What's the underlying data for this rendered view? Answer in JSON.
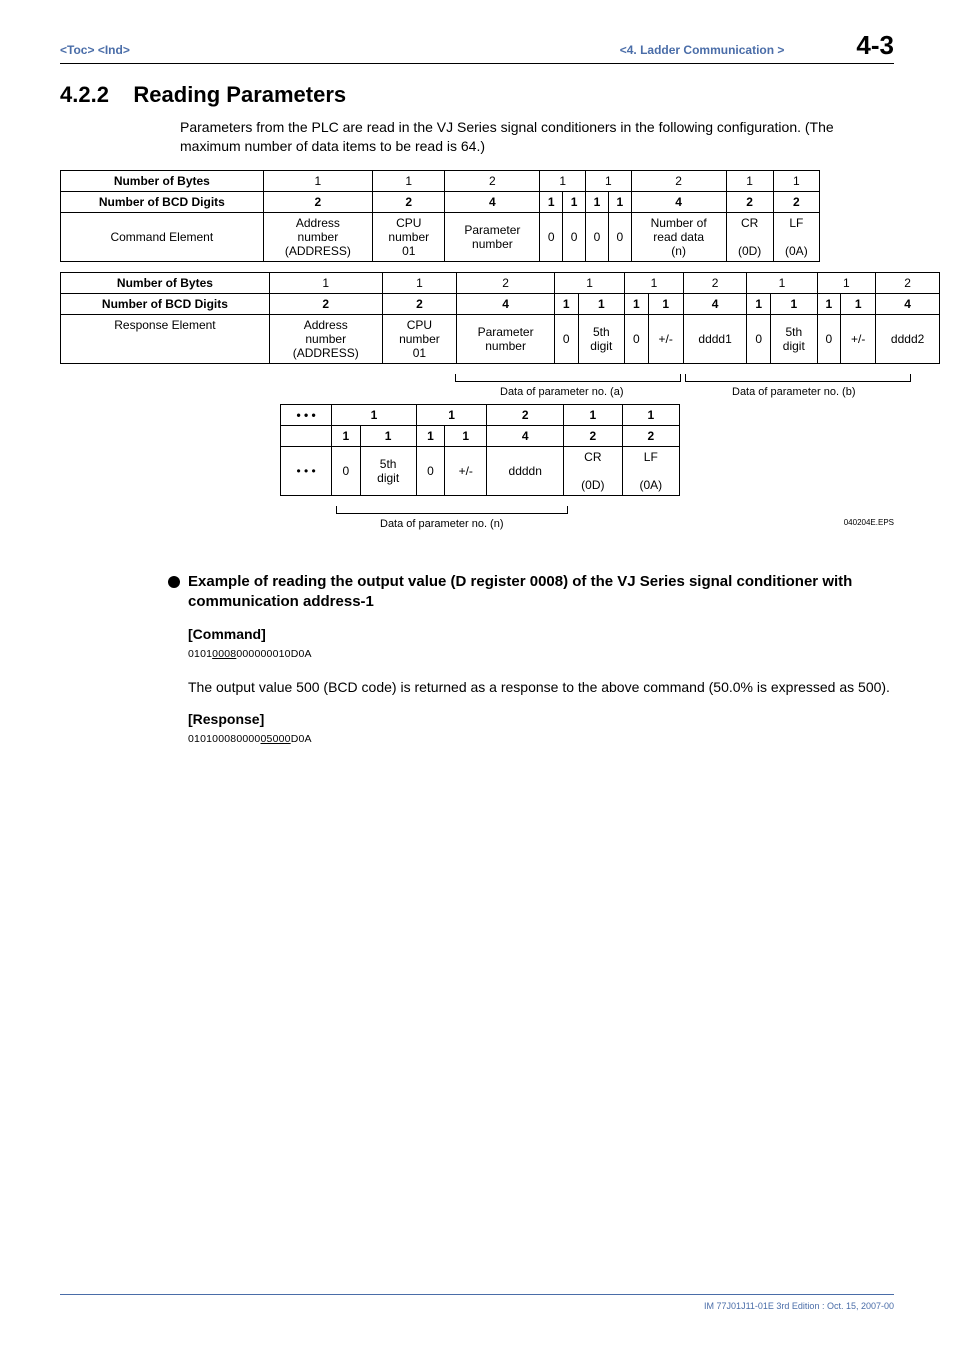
{
  "header": {
    "toc": "<Toc>",
    "ind": "<Ind>",
    "chapter_ref": "<4.  Ladder Communication >",
    "page_num": "4-3"
  },
  "section": {
    "number": "4.2.2",
    "title": "Reading Parameters",
    "intro": "Parameters from the PLC are read in the VJ Series signal conditioners in the following configuration. (The maximum number of data items to be read is 64.)"
  },
  "cmd_table": {
    "rows": {
      "bytes_label": "Number of Bytes",
      "bcd_label": "Number of BCD Digits",
      "elem_label": "Command Element"
    },
    "bytes": [
      "1",
      "1",
      "2",
      "1",
      "1",
      "2",
      "1",
      "1"
    ],
    "bcd": [
      "2",
      "2",
      "4",
      "1",
      "1",
      "1",
      "1",
      "4",
      "2",
      "2"
    ],
    "elem": {
      "c1": "Address\nnumber\n(ADDRESS)",
      "c2": "CPU\nnumber\n01",
      "c3": "Parameter\nnumber",
      "c4": "0",
      "c5": "0",
      "c6": "0",
      "c7": "0",
      "c8": "Number of\nread data\n(n)",
      "c9": "CR\n\n(0D)",
      "c10": "LF\n\n(0A)"
    }
  },
  "rsp_table": {
    "rows": {
      "bytes_label": "Number of Bytes",
      "bcd_label": "Number of BCD Digits",
      "elem_label": "Response Element"
    },
    "bytes": [
      "1",
      "1",
      "2",
      "1",
      "1",
      "2",
      "1",
      "1",
      "2"
    ],
    "bcd": [
      "2",
      "2",
      "4",
      "1",
      "1",
      "1",
      "1",
      "4",
      "1",
      "1",
      "1",
      "1",
      "4"
    ],
    "elem": {
      "c1": "Address\nnumber\n(ADDRESS)",
      "c2": "CPU\nnumber\n01",
      "c3": "Parameter\nnumber",
      "c4": "0",
      "c5": "5th\ndigit",
      "c6": "0",
      "c7": "+/-",
      "c8": "dddd1",
      "c9": "0",
      "c10": "5th\ndigit",
      "c11": "0",
      "c12": "+/-",
      "c13": "dddd2"
    }
  },
  "bracket_labels": {
    "a": "Data of parameter no. (a)",
    "b": "Data of parameter no. (b)",
    "n": "Data of parameter no. (n)"
  },
  "cont_table": {
    "ellipsis": "• • •",
    "bytes": [
      "1",
      "1",
      "2",
      "1",
      "1"
    ],
    "bcd": [
      "1",
      "1",
      "1",
      "1",
      "4",
      "2",
      "2"
    ],
    "elem": {
      "c1": "0",
      "c2": "5th\ndigit",
      "c3": "0",
      "c4": "+/-",
      "c5": "ddddn",
      "c6": "CR\n\n(0D)",
      "c7": "LF\n\n(0A)"
    }
  },
  "eps": "040204E.EPS",
  "example": {
    "title": "Example of reading the output value (D register 0008) of the VJ Series signal conditioner with communication address-1",
    "cmd_head": "[Command]",
    "cmd_pre": "0101",
    "cmd_underline": "0008",
    "cmd_post": "000000010D0A",
    "body": "The output value 500 (BCD code) is returned as a response to the above command (50.0% is expressed as 500).",
    "rsp_head": "[Response]",
    "rsp_pre": "010100080000",
    "rsp_underline": "05000",
    "rsp_post": "D0A"
  },
  "footer": "IM 77J01J11-01E    3rd Edition : Oct. 15, 2007-00"
}
